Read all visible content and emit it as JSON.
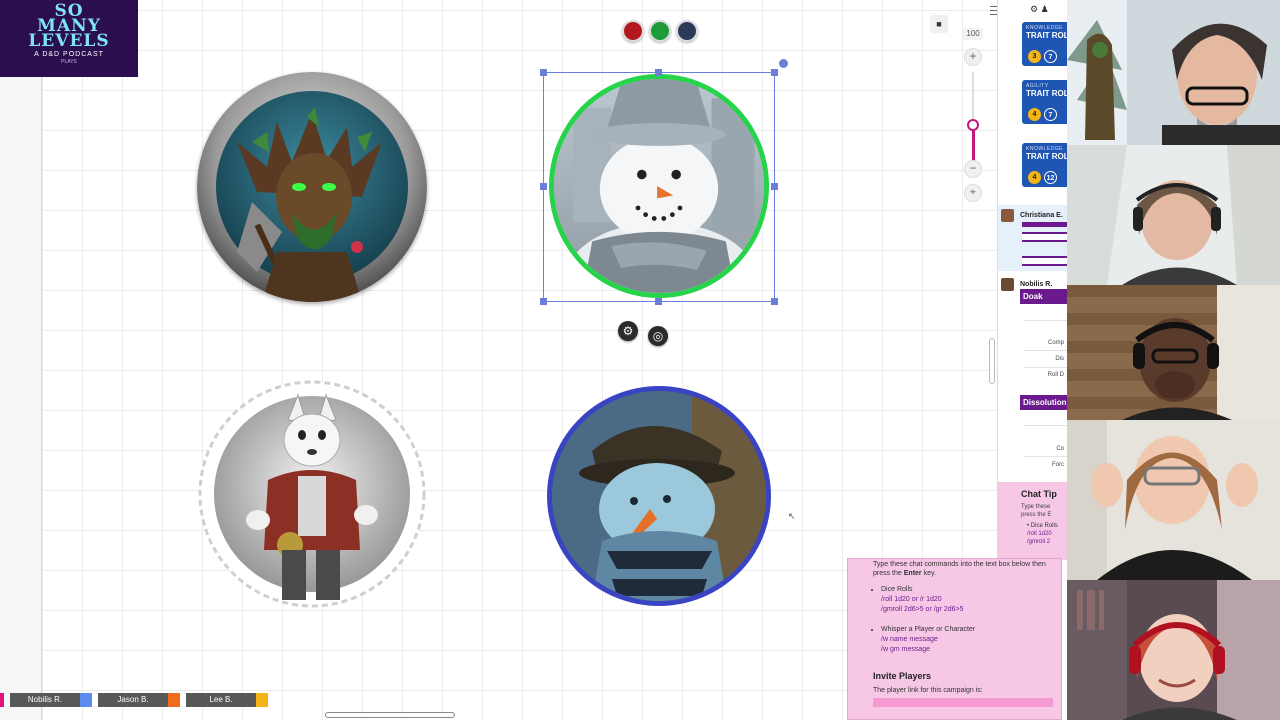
{
  "logo": {
    "line1": "SO",
    "line2": "MANY",
    "line3": "LEVELS",
    "tagline": "A D&D PODCAST",
    "small": "PLAYS"
  },
  "colors": {
    "red": "#b3161c",
    "green": "#1e9b3a",
    "navy": "#2c3a5a",
    "zoom_accent": "#c8147d",
    "trait_blue": "#1f56b3",
    "purple": "#6a1a8c",
    "tips_pink": "#f6c8e6"
  },
  "zoom": {
    "value": "100",
    "plus": "+",
    "minus": "−"
  },
  "token_controls": {
    "settings_icon": "⚙",
    "target_icon": "◎"
  },
  "side_panel": {
    "traits": [
      {
        "sub": "KNOWLEDGE",
        "title": "TRAIT ROL",
        "die1": "3",
        "die2": "7"
      },
      {
        "sub": "AGILITY",
        "title": "TRAIT ROL",
        "die1": "4",
        "die2": "7"
      },
      {
        "sub": "KNOWLEDGE",
        "title": "TRAIT ROL",
        "die1": "4",
        "die2": "12"
      }
    ],
    "msg1_name": "Christiana E.",
    "msg2_name": "Nobilis R.",
    "doak_label": "Doak",
    "rows": [
      "Comp",
      "Dis",
      "Roll D"
    ],
    "dissolution_label": "Dissolution",
    "rows2": [
      "Co",
      "Forc"
    ],
    "chat_tips_title": "Chat Tip",
    "chat_tips_text1": "Type these",
    "chat_tips_text2": "press the E",
    "chat_tips_bullet": "Dice Rolls",
    "chat_tips_cmd1": "/roll 1d20",
    "chat_tips_cmd2": "/gmroll 2"
  },
  "tips_popup": {
    "intro_a": "Type these chat commands into the text box below then",
    "intro_b": "press the",
    "intro_key": "Enter",
    "intro_c": "key.",
    "dice_title": "Dice Rolls",
    "dice_cmd1": "/roll 1d20 or /r 1d20",
    "dice_cmd2": "/gmroll 2d6>5 or /gr 2d6>5",
    "whisper_title": "Whisper a Player or Character",
    "whisper_cmd1": "/w name message",
    "whisper_cmd2": "/w gm message",
    "invite_title": "Invite Players",
    "invite_text": "The player link for this campaign is:"
  },
  "players": [
    {
      "name": "Nobilis R.",
      "color": "#5b8def"
    },
    {
      "name": "Jason B.",
      "color": "#f26a1b"
    },
    {
      "name": "Lee B.",
      "color": "#f2b416"
    }
  ],
  "lock_icon": "■"
}
